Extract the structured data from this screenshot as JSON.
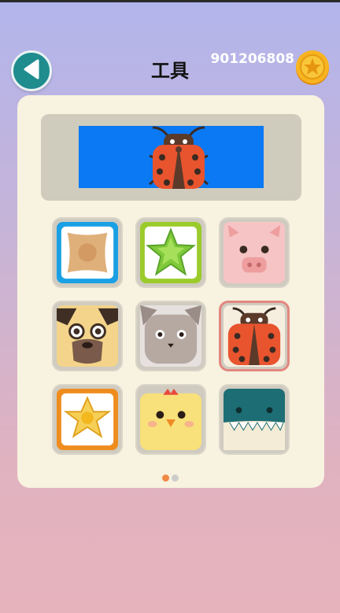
{
  "header": {
    "title": "工具",
    "coin_count": "901206808"
  },
  "colors": {
    "back_button": "#1f8c8e",
    "panel": "#f8f2e0",
    "preview_screen": "#0b78f4",
    "selected_border": "#e3877f",
    "dot_active": "#f08a44",
    "dot_inactive": "#cccccc"
  },
  "preview": {
    "item_icon": "ladybug-icon"
  },
  "items": [
    {
      "icon": "square-tile-icon",
      "selected": false
    },
    {
      "icon": "star-tile-icon",
      "selected": false
    },
    {
      "icon": "pig-icon",
      "selected": false
    },
    {
      "icon": "pug-icon",
      "selected": false
    },
    {
      "icon": "cat-icon",
      "selected": false
    },
    {
      "icon": "ladybug-icon",
      "selected": true
    },
    {
      "icon": "flower-tile-icon",
      "selected": false
    },
    {
      "icon": "chick-icon",
      "selected": false
    },
    {
      "icon": "whale-icon",
      "selected": false
    }
  ],
  "pagination": {
    "current_page": 1,
    "total_pages": 2
  }
}
